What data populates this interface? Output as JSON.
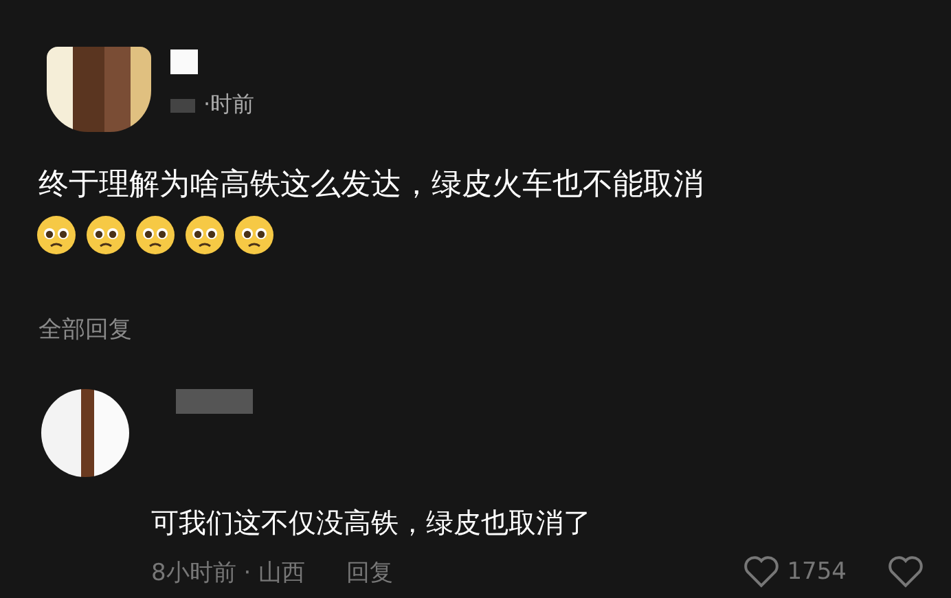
{
  "post": {
    "time": "·时前",
    "text": "终于理解为啥高铁这么发达，绿皮火车也不能取消",
    "emojis": [
      {
        "kind": "pleading"
      },
      {
        "kind": "pleading"
      },
      {
        "kind": "pleading"
      },
      {
        "kind": "pleading"
      },
      {
        "kind": "pleading"
      }
    ]
  },
  "replies_header": "全部回复",
  "reply": {
    "text": "可我们这不仅没高铁，绿皮也取消了",
    "time": "8小时前 · 山西",
    "reply_label": "回复",
    "likes": "1754"
  }
}
